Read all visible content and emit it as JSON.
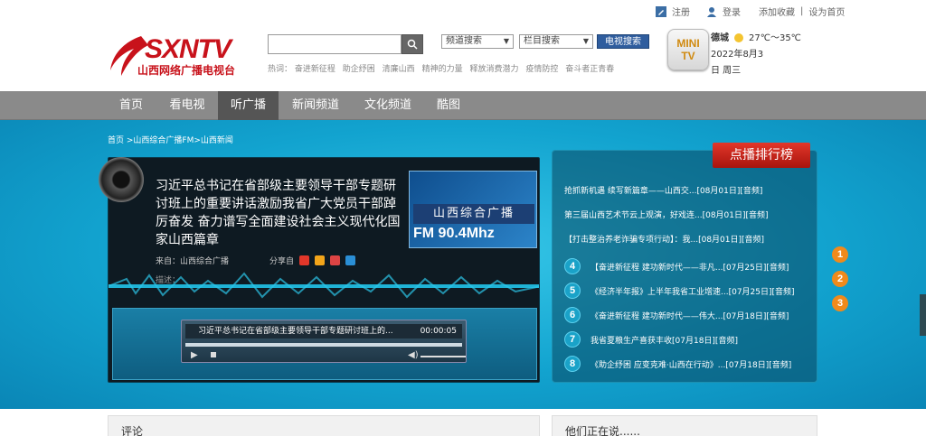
{
  "toplinks": {
    "register": "注册",
    "login": "登录",
    "favorite": "添加收藏",
    "divider": "|",
    "homepage": "设为首页"
  },
  "logo": {
    "main": "SXNTV",
    "sub": "山西网络广播电视台"
  },
  "search": {
    "input_value": "",
    "channel_select": "频道搜索",
    "column_select": "栏目搜索",
    "tv_search_label": "电视搜索"
  },
  "hotwords": {
    "label": "热词：",
    "items": [
      "奋进新征程",
      "助企纾困",
      "清廉山西",
      "精神的力量",
      "释放消费潜力",
      "疫情防控",
      "奋斗者正青春"
    ]
  },
  "minitv": {
    "line1": "MINI",
    "line2": "TV"
  },
  "weather": {
    "city": "德城",
    "temp": "27℃～35℃",
    "date": "2022年8月3",
    "weekday": "日  周三"
  },
  "nav": {
    "items": [
      "首页",
      "看电视",
      "听广播",
      "新闻频道",
      "文化频道",
      "酷图"
    ],
    "active": "听广播"
  },
  "breadcrumb": "首页 >山西综合广播FM>山西新闻",
  "player": {
    "headline": "习近平总书记在省部级主要领导干部专题研讨班上的重要讲话激励我省广大党员干部踔厉奋发 奋力谱写全面建设社会主义现代化国家山西篇章",
    "source": "来自：山西综合广播",
    "share_label": "分享自",
    "desc_label": "描述：",
    "radio_logo_cn": "山西综合广播",
    "radio_logo_fm": "FM 90.4Mhz",
    "bar_title": "习近平总书记在省部级主要领导干部专题研讨班上的...",
    "bar_time": "00:00:05"
  },
  "ranking": {
    "title": "点播排行榜",
    "items": [
      {
        "num": "1",
        "text": "抢抓新机遇 续写新篇章——山西交...[08月01日][音频]"
      },
      {
        "num": "2",
        "text": "第三届山西艺术节云上观演，好戏连...[08月01日][音频]"
      },
      {
        "num": "3",
        "text": "【打击整治养老诈骗专项行动】：我...[08月01日][音频]"
      },
      {
        "num": "4",
        "text": "【奋进新征程 建功新时代——非凡...[07月25日][音频]"
      },
      {
        "num": "5",
        "text": "《经济半年报》上半年我省工业增速...[07月25日][音频]"
      },
      {
        "num": "6",
        "text": "《奋进新征程 建功新时代——伟大...[07月18日][音频]"
      },
      {
        "num": "7",
        "text": "我省夏粮生产喜获丰收[07月18日][音频]"
      },
      {
        "num": "8",
        "text": "《助企纾困 应变克难·山西在行动》...[07月18日][音频]"
      }
    ]
  },
  "bottom": {
    "comments": "评论",
    "talking": "他们正在说......"
  },
  "colors": {
    "brand_red": "#c8121b",
    "banner_blue": "#12a3cf",
    "nav_gray": "#8a8a8a",
    "rank_orange": "#f08a1b"
  }
}
